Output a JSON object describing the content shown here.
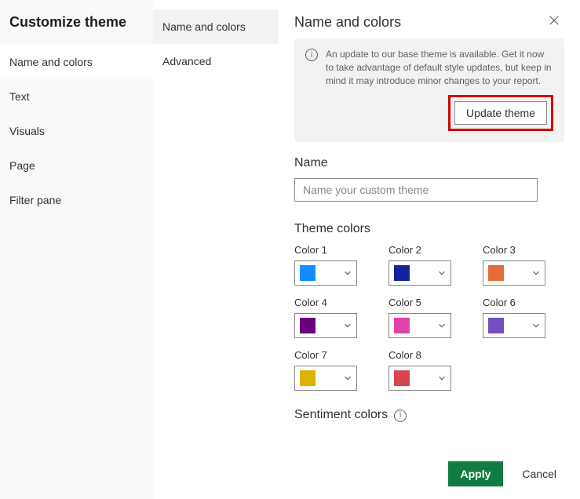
{
  "dialog_title": "Customize theme",
  "nav": {
    "items": [
      {
        "label": "Name and colors",
        "selected": true
      },
      {
        "label": "Text",
        "selected": false
      },
      {
        "label": "Visuals",
        "selected": false
      },
      {
        "label": "Page",
        "selected": false
      },
      {
        "label": "Filter pane",
        "selected": false
      }
    ]
  },
  "subnav": {
    "items": [
      {
        "label": "Name and colors",
        "selected": true
      },
      {
        "label": "Advanced",
        "selected": false
      }
    ]
  },
  "panel": {
    "title": "Name and colors",
    "update_message": "An update to our base theme is available. Get it now to take advantage of default style updates, but keep in mind it may introduce minor changes to your report.",
    "update_button": "Update theme",
    "name_label": "Name",
    "name_placeholder": "Name your custom theme",
    "theme_colors_label": "Theme colors",
    "colors": [
      {
        "label": "Color 1",
        "hex": "#118dff"
      },
      {
        "label": "Color 2",
        "hex": "#12239e"
      },
      {
        "label": "Color 3",
        "hex": "#e66c37"
      },
      {
        "label": "Color 4",
        "hex": "#6b007b"
      },
      {
        "label": "Color 5",
        "hex": "#e044a7"
      },
      {
        "label": "Color 6",
        "hex": "#744ec2"
      },
      {
        "label": "Color 7",
        "hex": "#d9b300"
      },
      {
        "label": "Color 8",
        "hex": "#d64550"
      }
    ],
    "sentiment_label": "Sentiment colors"
  },
  "footer": {
    "apply": "Apply",
    "cancel": "Cancel"
  }
}
